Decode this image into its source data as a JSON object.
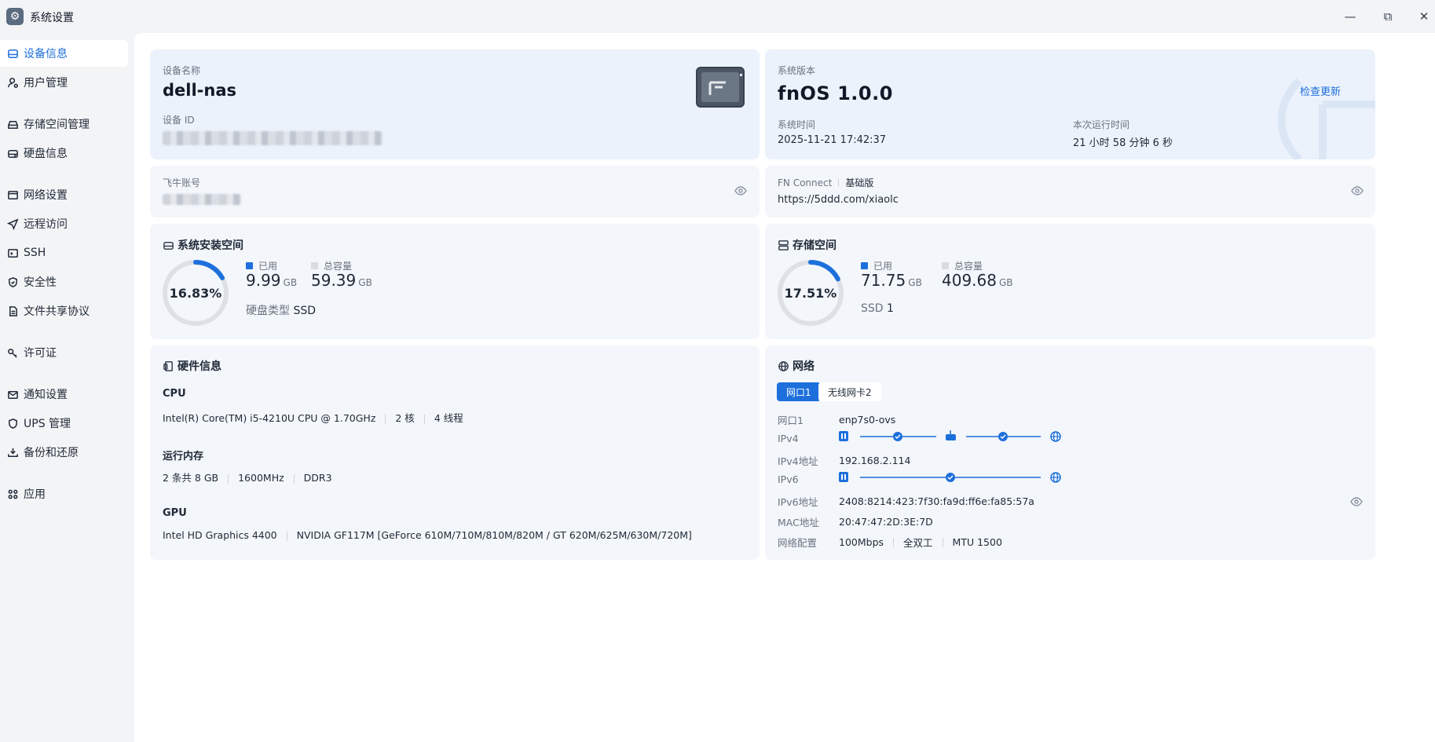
{
  "app": {
    "title": "系统设置",
    "icon": "gear-icon"
  },
  "window": {
    "minimize": "—",
    "restore": "⧉",
    "close": "✕"
  },
  "sidebar": {
    "items": [
      {
        "label": "设备信息",
        "icon": "device-icon",
        "active": true
      },
      {
        "label": "用户管理",
        "icon": "user-gear-icon"
      },
      {
        "label": "存储空间管理",
        "icon": "storage-icon"
      },
      {
        "label": "硬盘信息",
        "icon": "disk-icon"
      },
      {
        "label": "网络设置",
        "icon": "network-icon"
      },
      {
        "label": "远程访问",
        "icon": "send-icon"
      },
      {
        "label": "SSH",
        "icon": "terminal-icon"
      },
      {
        "label": "安全性",
        "icon": "shield-icon"
      },
      {
        "label": "文件共享协议",
        "icon": "file-icon"
      },
      {
        "label": "许可证",
        "icon": "key-icon"
      },
      {
        "label": "通知设置",
        "icon": "mail-icon"
      },
      {
        "label": "UPS 管理",
        "icon": "shield-icon"
      },
      {
        "label": "备份和还原",
        "icon": "backup-icon"
      },
      {
        "label": "应用",
        "icon": "apps-icon"
      }
    ]
  },
  "device": {
    "name_label": "设备名称",
    "name": "dell-nas",
    "id_label": "设备 ID"
  },
  "system": {
    "version_label": "系统版本",
    "version": "fnOS  1.0.0",
    "check_update": "检查更新",
    "time_label": "系统时间",
    "time": "2025-11-21 17:42:37",
    "uptime_label": "本次运行时间",
    "uptime": "21 小时 58 分钟 6 秒"
  },
  "account": {
    "label": "飞牛账号"
  },
  "fnconnect": {
    "label": "FN Connect",
    "plan": "基础版",
    "url": "https://5ddd.com/xiaolc"
  },
  "sys_space": {
    "title": "系统安装空间",
    "percent": "16.83%",
    "fraction": 0.1683,
    "used_label": "已用",
    "used": "9.99",
    "used_unit": "GB",
    "total_label": "总容量",
    "total": "59.39",
    "total_unit": "GB",
    "disk_type_label": "硬盘类型",
    "disk_type": "SSD"
  },
  "storage": {
    "title": "存储空间",
    "percent": "17.51%",
    "fraction": 0.1751,
    "used_label": "已用",
    "used": "71.75",
    "used_unit": "GB",
    "total_label": "总容量",
    "total": "409.68",
    "total_unit": "GB",
    "ssd_label": "SSD",
    "ssd_count": "1"
  },
  "hardware": {
    "title": "硬件信息",
    "cpu_label": "CPU",
    "cpu_model": "Intel(R) Core(TM) i5-4210U CPU @ 1.70GHz",
    "cpu_cores": "2 核",
    "cpu_threads": "4 线程",
    "mem_label": "运行内存",
    "mem_size": "2 条共 8 GB",
    "mem_freq": "1600MHz",
    "mem_type": "DDR3",
    "gpu_label": "GPU",
    "gpu1": "Intel HD Graphics 4400",
    "gpu2": "NVIDIA GF117M [GeForce 610M/710M/810M/820M / GT 620M/625M/630M/720M]"
  },
  "network": {
    "title": "网络",
    "tabs": [
      "网口1",
      "无线网卡2"
    ],
    "port_label": "网口1",
    "port": "enp7s0-ovs",
    "ipv4_label": "IPv4",
    "ipv4_addr_label": "IPv4地址",
    "ipv4_addr": "192.168.2.114",
    "ipv6_label": "IPv6",
    "ipv6_addr_label": "IPv6地址",
    "ipv6_addr": "2408:8214:423:7f30:fa9d:ff6e:fa85:57a",
    "mac_label": "MAC地址",
    "mac": "20:47:47:2D:3E:7D",
    "config_label": "网络配置",
    "speed": "100Mbps",
    "duplex": "全双工",
    "mtu": "MTU 1500"
  },
  "colors": {
    "accent": "#1d6fdc",
    "track": "#dde1e7"
  }
}
